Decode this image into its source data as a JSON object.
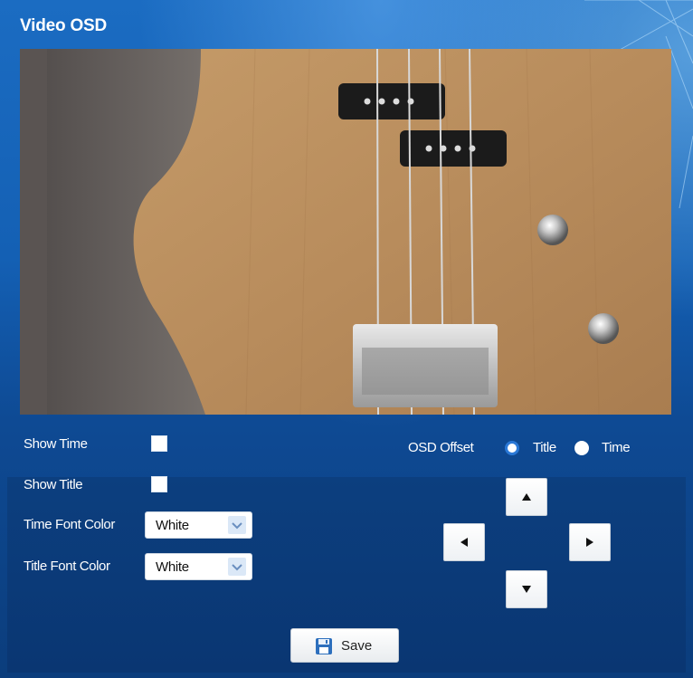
{
  "panel": {
    "title": "Video OSD"
  },
  "video": {
    "description_icon": "video-preview"
  },
  "controls": {
    "show_time_label": "Show Time",
    "show_time_checked": false,
    "show_title_label": "Show Title",
    "show_title_checked": false,
    "time_font_color_label": "Time Font Color",
    "time_font_color_value": "White",
    "title_font_color_label": "Title Font Color",
    "title_font_color_value": "White"
  },
  "osd_offset": {
    "label": "OSD Offset",
    "options": [
      {
        "label": "Title",
        "selected": true
      },
      {
        "label": "Time",
        "selected": false
      }
    ]
  },
  "arrows": {
    "up": "arrow-up-icon",
    "down": "arrow-down-icon",
    "left": "arrow-left-icon",
    "right": "arrow-right-icon"
  },
  "save": {
    "label": "Save",
    "icon": "floppy-disk-icon"
  },
  "colors": {
    "accent": "#2a78d6",
    "panel_bg": "#1460b4",
    "lower_bg": "#0c3f7f"
  }
}
